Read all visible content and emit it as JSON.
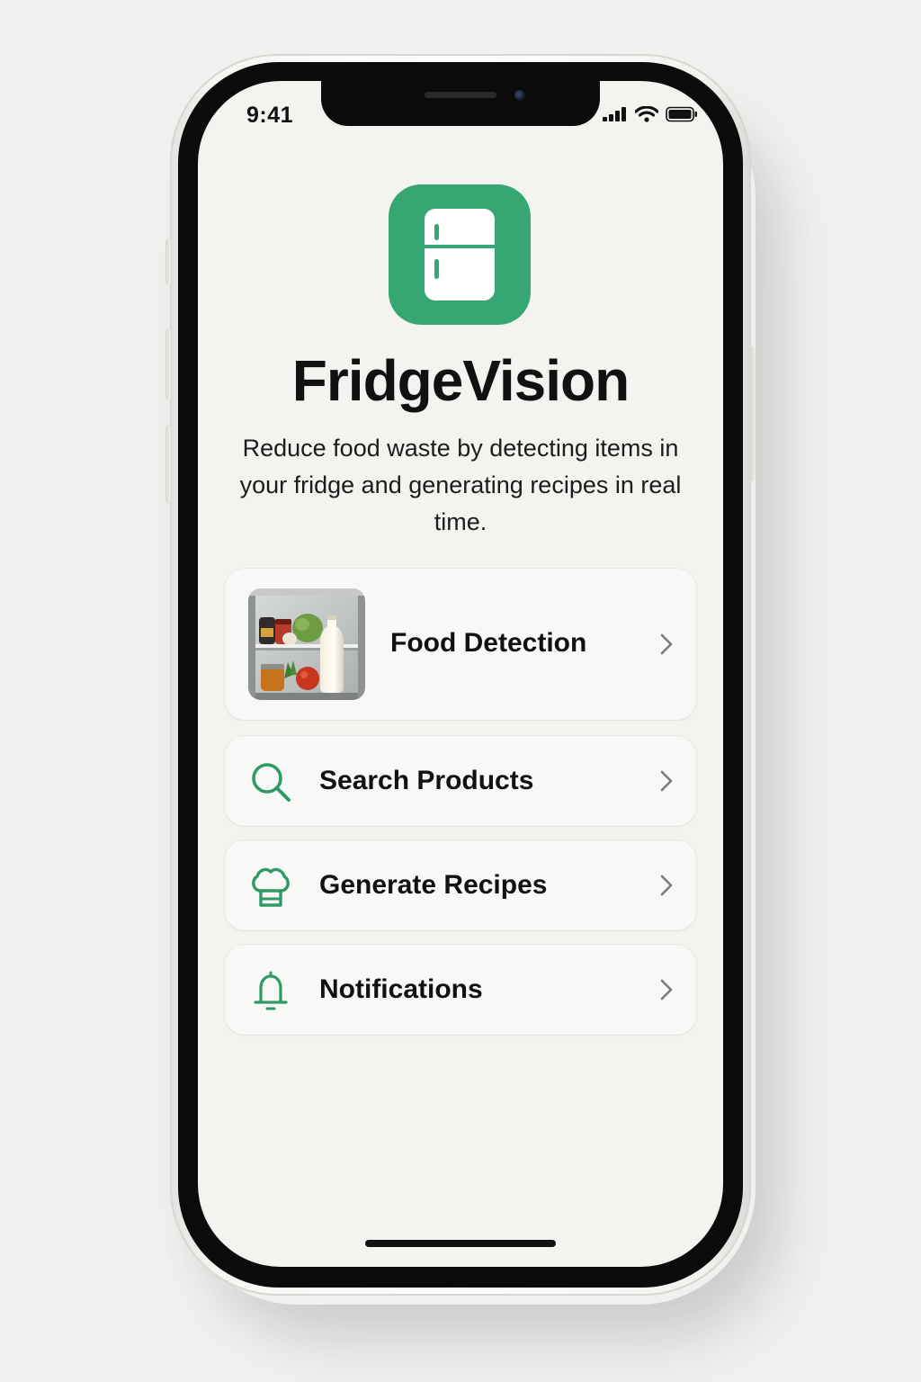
{
  "status_bar": {
    "time": "9:41",
    "signal_icon": "cellular-signal-icon",
    "wifi_icon": "wifi-icon",
    "battery_icon": "battery-icon"
  },
  "app": {
    "icon": "fridge-icon",
    "title": "FridgeVision",
    "description": "Reduce food waste by detecting items in your fridge and generating recipes in real time.",
    "accent_color": "#36a772"
  },
  "menu": {
    "items": [
      {
        "label": "Food Detection",
        "icon": "fridge-photo-thumbnail"
      },
      {
        "label": "Search Products",
        "icon": "search-icon"
      },
      {
        "label": "Generate Recipes",
        "icon": "chef-hat-icon"
      },
      {
        "label": "Notifications",
        "icon": "bell-icon"
      }
    ]
  }
}
